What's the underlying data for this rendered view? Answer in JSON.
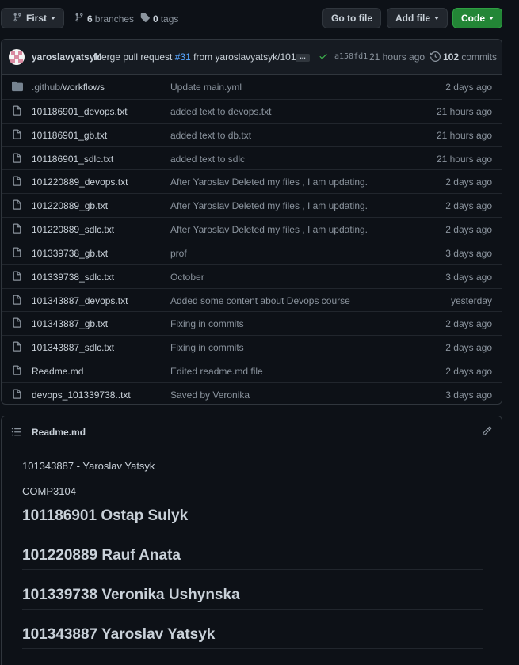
{
  "toolbar": {
    "branch_label": "First",
    "branches_count": "6",
    "branches_label": "branches",
    "tags_count": "0",
    "tags_label": "tags",
    "go_to_file_label": "Go to file",
    "add_file_label": "Add file",
    "code_label": "Code"
  },
  "commit": {
    "author": "yaroslavyatsyk",
    "message_prefix": "Merge pull request",
    "pr_number": "#31",
    "message_suffix": "from yaroslavyatsyk/101...",
    "ellipsis": "...",
    "sha": "a158fd1",
    "time": "21 hours ago",
    "commits_count": "102",
    "commits_label": "commits"
  },
  "files": [
    {
      "type": "folder",
      "name_dim": ".github/",
      "name": "workflows",
      "message": "Update main.yml",
      "age": "2 days ago"
    },
    {
      "type": "file",
      "name_dim": "",
      "name": "101186901_devops.txt",
      "message": "added text to devops.txt",
      "age": "21 hours ago"
    },
    {
      "type": "file",
      "name_dim": "",
      "name": "101186901_gb.txt",
      "message": "added text to db.txt",
      "age": "21 hours ago"
    },
    {
      "type": "file",
      "name_dim": "",
      "name": "101186901_sdlc.txt",
      "message": "added text to sdlc",
      "age": "21 hours ago"
    },
    {
      "type": "file",
      "name_dim": "",
      "name": "101220889_devops.txt",
      "message": "After Yaroslav Deleted my files , I am updating.",
      "age": "2 days ago"
    },
    {
      "type": "file",
      "name_dim": "",
      "name": "101220889_gb.txt",
      "message": "After Yaroslav Deleted my files , I am updating.",
      "age": "2 days ago"
    },
    {
      "type": "file",
      "name_dim": "",
      "name": "101220889_sdlc.txt",
      "message": "After Yaroslav Deleted my files , I am updating.",
      "age": "2 days ago"
    },
    {
      "type": "file",
      "name_dim": "",
      "name": "101339738_gb.txt",
      "message": "prof",
      "age": "3 days ago"
    },
    {
      "type": "file",
      "name_dim": "",
      "name": "101339738_sdlc.txt",
      "message": "October",
      "age": "3 days ago"
    },
    {
      "type": "file",
      "name_dim": "",
      "name": "101343887_devops.txt",
      "message": "Added some content about Devops course",
      "age": "yesterday"
    },
    {
      "type": "file",
      "name_dim": "",
      "name": "101343887_gb.txt",
      "message": "Fixing in commits",
      "age": "2 days ago"
    },
    {
      "type": "file",
      "name_dim": "",
      "name": "101343887_sdlc.txt",
      "message": "Fixing in commits",
      "age": "2 days ago"
    },
    {
      "type": "file",
      "name_dim": "",
      "name": "Readme.md",
      "message": "Edited readme.md file",
      "age": "2 days ago"
    },
    {
      "type": "file",
      "name_dim": "",
      "name": "devops_101339738..txt",
      "message": "Saved by Veronika",
      "age": "3 days ago"
    }
  ],
  "readme": {
    "title": "Readme.md",
    "paragraphs": [
      "101343887 - Yaroslav Yatsyk",
      "COMP3104"
    ],
    "headings": [
      "101186901 Ostap Sulyk",
      "101220889 Rauf Anata",
      "101339738 Veronika Ushynska",
      "101343887 Yaroslav Yatsyk"
    ]
  }
}
